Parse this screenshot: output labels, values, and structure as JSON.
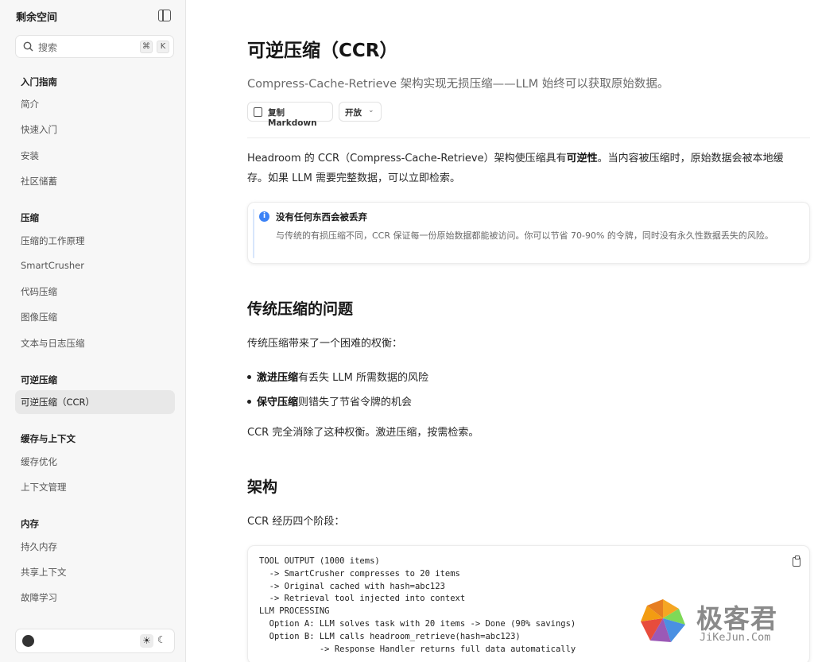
{
  "sidebar": {
    "title": "剩余空间",
    "search_placeholder": "搜索",
    "shortcut_mod": "⌘",
    "shortcut_key": "K",
    "groups": [
      {
        "label": "入门指南",
        "items": [
          "简介",
          "快速入门",
          "安装",
          "社区储蓄"
        ]
      },
      {
        "label": "压缩",
        "items": [
          "压缩的工作原理",
          "SmartCrusher",
          "代码压缩",
          "图像压缩",
          "文本与日志压缩"
        ]
      },
      {
        "label": "可逆压缩",
        "items": [
          "可逆压缩（CCR）"
        ]
      },
      {
        "label": "缓存与上下文",
        "items": [
          "缓存优化",
          "上下文管理"
        ]
      },
      {
        "label": "内存",
        "items": [
          "持久内存",
          "共享上下文",
          "故障学习"
        ]
      }
    ],
    "active_item": "可逆压缩（CCR）"
  },
  "page": {
    "title": "可逆压缩（CCR）",
    "subtitle": "Compress-Cache-Retrieve 架构实现无损压缩——LLM 始终可以获取原始数据。",
    "copy_button": "复制 Markdown",
    "open_button": "开放",
    "intro_line1_a": "Headroom 的 CCR（Compress-Cache-Retrieve）架构使压缩具有",
    "intro_line1_b": "可逆性",
    "intro_line1_c": "。当内容被压缩时，原始数据会被本地缓",
    "intro_line2": "存。如果 LLM 需要完整数据，可以立即检索。",
    "callout_title": "没有任何东西会被丢弃",
    "callout_body": "与传统的有损压缩不同，CCR 保证每一份原始数据都能被访问。你可以节省 70-90% 的令牌，同时没有永久性数据丢失的风险。",
    "section1_title": "传统压缩的问题",
    "section1_intro": "传统压缩带来了一个困难的权衡：",
    "bullet1_bold": "激进压缩",
    "bullet1_rest": "有丢失 LLM 所需数据的风险",
    "bullet2_bold": "保守压缩",
    "bullet2_rest": "则错失了节省令牌的机会",
    "section1_outro": "CCR 完全消除了这种权衡。激进压缩，按需检索。",
    "section2_title": "架构",
    "section2_intro": "CCR 经历四个阶段：",
    "code": "TOOL OUTPUT (1000 items)\n  -> SmartCrusher compresses to 20 items\n  -> Original cached with hash=abc123\n  -> Retrieval tool injected into context\nLLM PROCESSING\n  Option A: LLM solves task with 20 items -> Done (90% savings)\n  Option B: LLM calls headroom_retrieve(hash=abc123)\n            -> Response Handler returns full data automatically"
  },
  "watermark": {
    "cn": "极客君",
    "en": "JiKeJun.Com"
  },
  "colors": {
    "accent": "#3b82f6",
    "sidebar_bg": "#f7f7f7",
    "active_bg": "#e8e8e8"
  }
}
